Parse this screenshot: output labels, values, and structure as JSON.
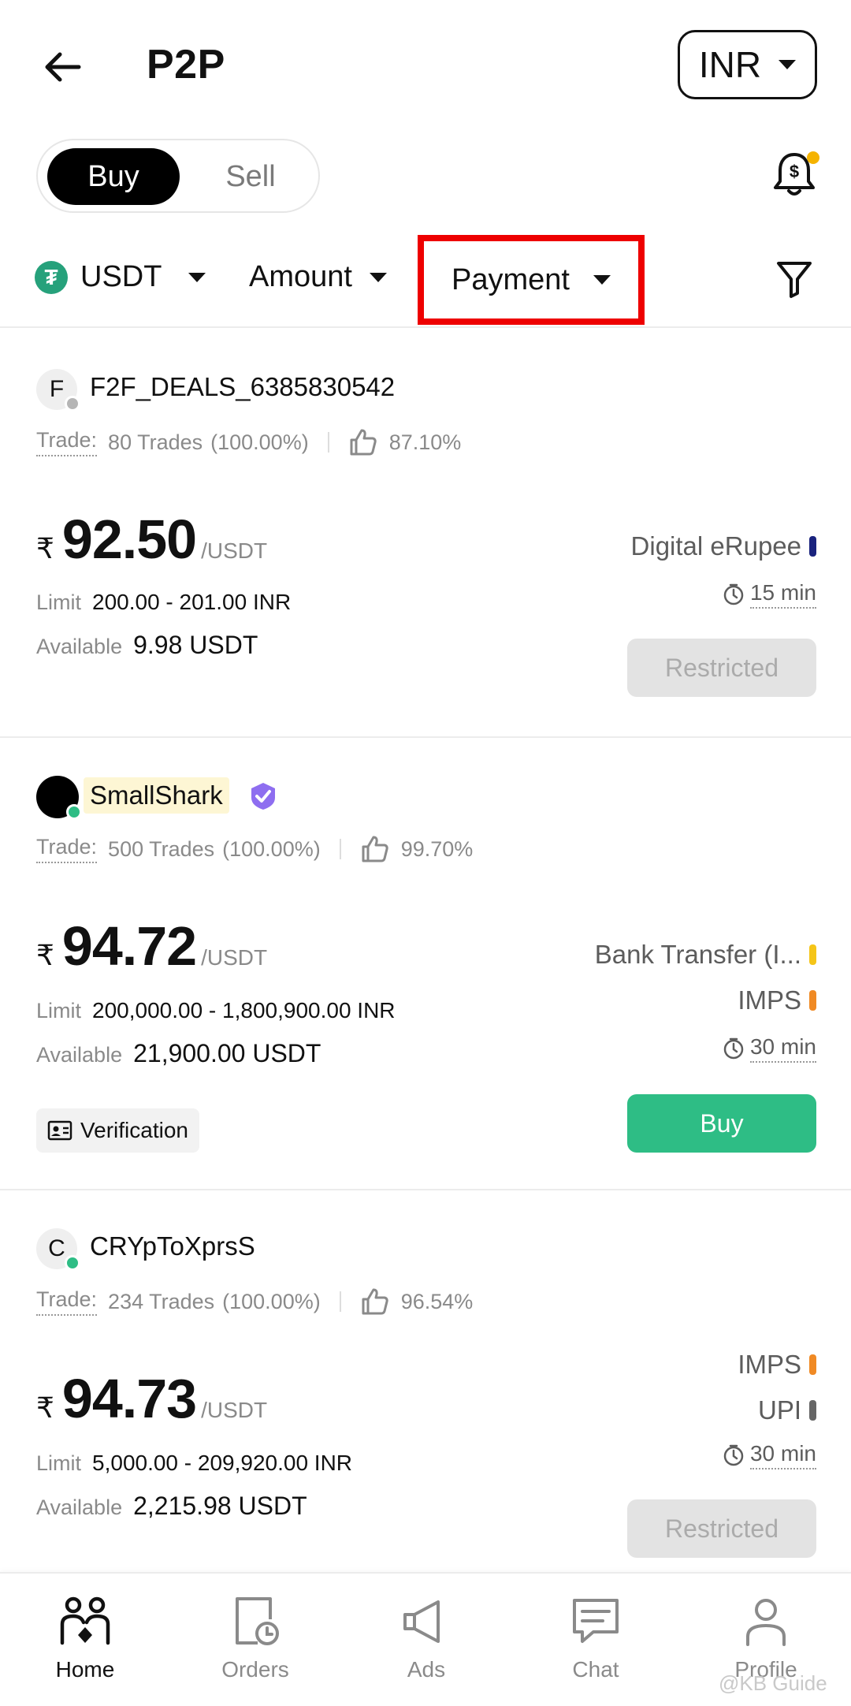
{
  "header": {
    "title": "P2P",
    "currency": "INR"
  },
  "toggle": {
    "buy": "Buy",
    "sell": "Sell"
  },
  "filters": {
    "asset": "USDT",
    "amount": "Amount",
    "payment": "Payment"
  },
  "listings": [
    {
      "avatar_letter": "F",
      "username": "F2F_DEALS_6385830542",
      "trade_label": "Trade:",
      "trades": "80 Trades",
      "completion": "(100.00%)",
      "rating": "87.10%",
      "currency_symbol": "₹",
      "price": "92.50",
      "unit": "/USDT",
      "limit_label": "Limit",
      "limit": "200.00 - 201.00 INR",
      "available_label": "Available",
      "available": "9.98 USDT",
      "payments": [
        "Digital eRupee"
      ],
      "time": "15 min",
      "action": "Restricted"
    },
    {
      "username": "SmallShark",
      "trade_label": "Trade:",
      "trades": "500 Trades",
      "completion": "(100.00%)",
      "rating": "99.70%",
      "currency_symbol": "₹",
      "price": "94.72",
      "unit": "/USDT",
      "limit_label": "Limit",
      "limit": "200,000.00 - 1,800,900.00 INR",
      "available_label": "Available",
      "available": "21,900.00 USDT",
      "payments": [
        "Bank Transfer (I...",
        "IMPS"
      ],
      "time": "30 min",
      "verification": "Verification",
      "action": "Buy"
    },
    {
      "avatar_letter": "C",
      "username": "CRYpToXprsS",
      "trade_label": "Trade:",
      "trades": "234 Trades",
      "completion": "(100.00%)",
      "rating": "96.54%",
      "currency_symbol": "₹",
      "price": "94.73",
      "unit": "/USDT",
      "limit_label": "Limit",
      "limit": "5,000.00 - 209,920.00 INR",
      "available_label": "Available",
      "available": "2,215.98 USDT",
      "payments": [
        "IMPS",
        "UPI"
      ],
      "time": "30 min",
      "action": "Restricted"
    }
  ],
  "nav": {
    "home": "Home",
    "orders": "Orders",
    "ads": "Ads",
    "chat": "Chat",
    "profile": "Profile"
  },
  "watermark": "@KB Guide",
  "colors": {
    "buy_green": "#2ebd85",
    "highlight_red": "#ee0000",
    "tether_green": "#26a17b",
    "erupee_bar": "#1a237e",
    "bank_bar": "#f5c518",
    "imps_bar": "#f08a24",
    "upi_bar": "#666666"
  }
}
